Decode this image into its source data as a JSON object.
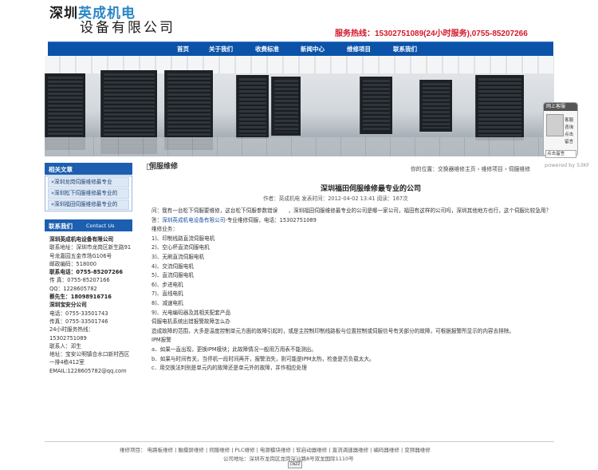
{
  "header": {
    "logo_line1_prefix": "深圳",
    "logo_line1_highlight": "英成机电",
    "logo_line2": "设备有限公司",
    "hotline": "服务热线：15302751089(24小时服务),0755-85207266"
  },
  "nav": {
    "items": [
      "首页",
      "关于我们",
      "收费标准",
      "新闻中心",
      "维修项目",
      "联系我们"
    ]
  },
  "sidebar": {
    "related_title": "相关文章",
    "related_links": [
      "»深圳龙岗伺服维修最专业",
      "»深圳松下伺服维修最专业的",
      "»深圳福田伺服维修最专业的"
    ],
    "contact_title": "联系我们",
    "contact_title_en": "Contact Us",
    "contact_lines": [
      "深圳英成机电设备有限公司",
      "联系地址：深圳市龙岗区新生路91号龙嘉园五金市场G106号",
      "邮政编码：518000",
      "联系电话：0755-85207266",
      "传 真：0755-85207166",
      "QQ：1228605782",
      "蔡先生：18098916716",
      "深圳宝安分公司",
      "电话：0755-33501743",
      "传真：0755-33501746",
      "24小时服务热线：",
      "15302751089",
      "联系人：邓生",
      "地址：宝安公明镇合水口新村西区一排4栋412室",
      "EMAIL:1228605782@qq.com"
    ]
  },
  "content": {
    "section_title": "伺服维修",
    "breadcrumb": "你的位置：交换器维修主页 › 维修项目 › 伺服维修",
    "article_title": "深圳福田伺服维修最专业的公司",
    "article_meta": "作者：英成机电 发表时间：2012-04-02 13:41 阅读：167次",
    "paragraphs": [
      "问：我有一台松下伺服要维修，这台松下伺服参数错误　　，深圳福田伺服维修最专业的公司是哪一家公司，福田有这样的公司吗，深圳其他地方也行，这个伺服比较急用？",
      "答：",
      "深圳英成机电设备有限公司",
      "-专业维修伺服，电话：15302751089",
      "维修业务：",
      "1)、印制线路直流伺服电机",
      "2)、空心杯直流伺服电机",
      "3)、无刷直流伺服电机",
      "4)、交流伺服电机",
      "5)、直流伺服电机",
      "6)、步进电机",
      "7)、直线电机",
      "8)、减速电机",
      "9)、光电编码器及其相关配套产品",
      "伺服电机系统出错报警故障怎么办",
      "造成故障的范围，大多是温度控制单元方面的故障引起的，或是主控制印制线路板与位置控制或伺服信号有关部分的故障，可根据报警所显示的内容去排除。",
      "IPM报警",
      "a．如果一直出现，更换IPM模块；此故障情况一般用万用表不能测出。",
      "b．如果与时间有关，当停机一段时间再开，报警消失，则可能是IPM太热，检查是否负载太大。",
      "c．用交换法判别是单元内的故障还是单元外的故障，并作相应处理"
    ]
  },
  "qq_widget": {
    "header": "网上客服",
    "line1": "客服咨询",
    "line2": "点击留言",
    "input_label": "点击留言",
    "powered": "powered by 53KF"
  },
  "footer": {
    "links_line": "维修项目： 电路板维修 | 触摸屏维修 | 伺服维修 | PLC维修 | 电源模块维修 | 软启动器维修 | 直流调速器维修 | 编码器维修 | 变频器维修",
    "address_line": "公司地址：深圳市龙岗区龙岗深汕路8号双龙国际1110号",
    "badge": "CNZZ"
  }
}
